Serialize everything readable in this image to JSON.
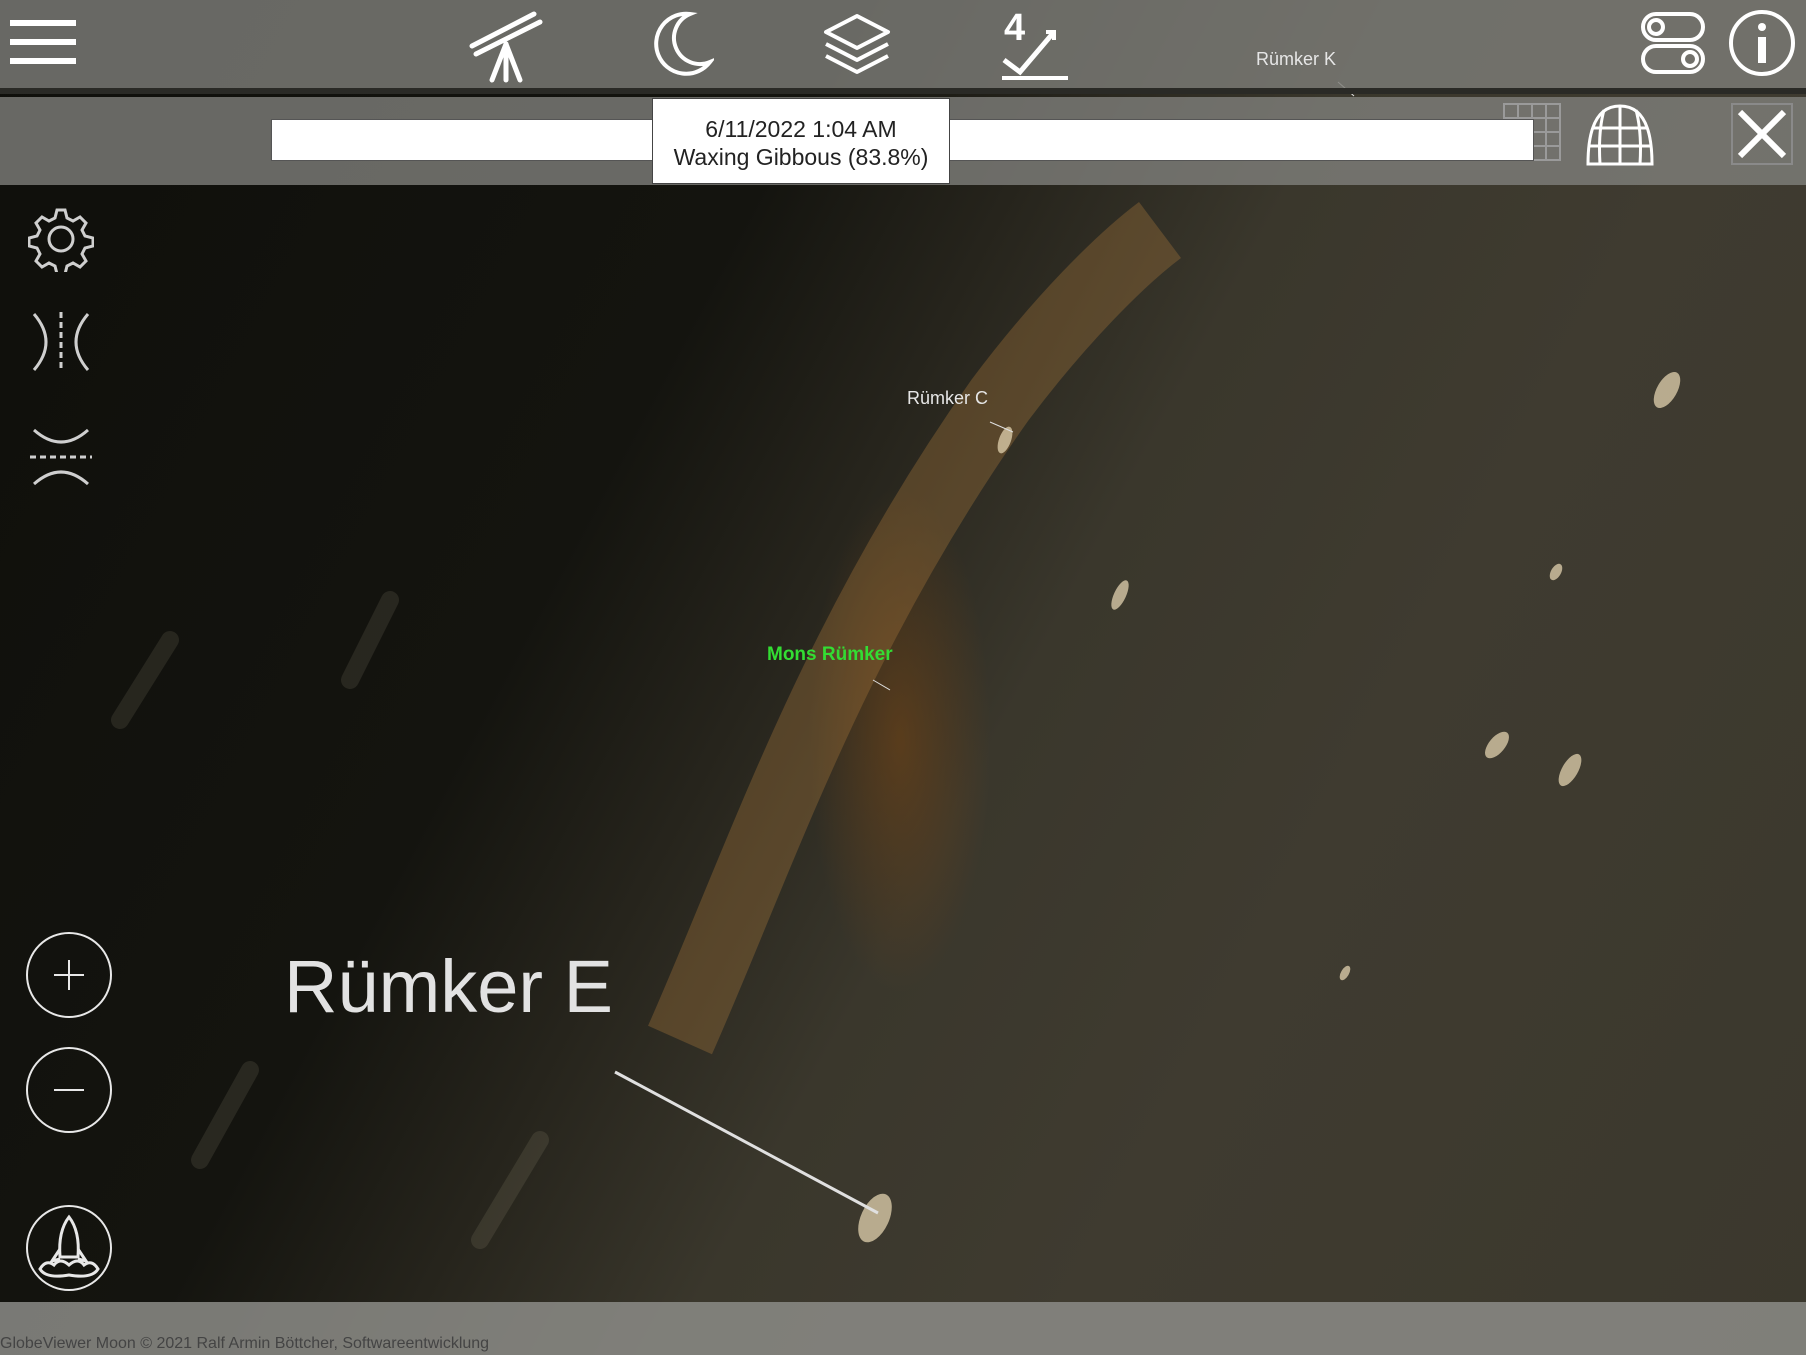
{
  "app": {
    "copyright": "GlobeViewer Moon © 2021 Ralf Armin Böttcher, Softwareentwicklung"
  },
  "toolbar": {
    "items": [
      {
        "name": "menu",
        "icon": "hamburger-menu-icon"
      },
      {
        "name": "telescope",
        "icon": "telescope-icon"
      },
      {
        "name": "moon-phase",
        "icon": "crescent-moon-icon"
      },
      {
        "name": "layers",
        "icon": "layers-icon"
      },
      {
        "name": "level",
        "icon": "checkmark-level-icon",
        "badge": "4"
      },
      {
        "name": "toggles",
        "icon": "toggle-switches-icon"
      },
      {
        "name": "info",
        "icon": "info-icon"
      }
    ]
  },
  "timebar": {
    "date": "6/11/2022 1:04 AM",
    "phase": "Waxing Gibbous (83.8%)"
  },
  "side_tools": [
    {
      "name": "settings",
      "icon": "gear-icon"
    },
    {
      "name": "mirror-horizontal",
      "icon": "mirror-horizontal-icon"
    },
    {
      "name": "mirror-vertical",
      "icon": "mirror-vertical-icon"
    }
  ],
  "map_labels": {
    "rumker_k": "Rümker K",
    "rumker_c": "Rümker C",
    "mons_rumker": "Mons Rümker",
    "rumker_e": "Rümker E"
  },
  "colors": {
    "toolbar_bg": "#7d7d78",
    "icon_color": "#ffffff",
    "highlight_label": "#33dd33"
  }
}
